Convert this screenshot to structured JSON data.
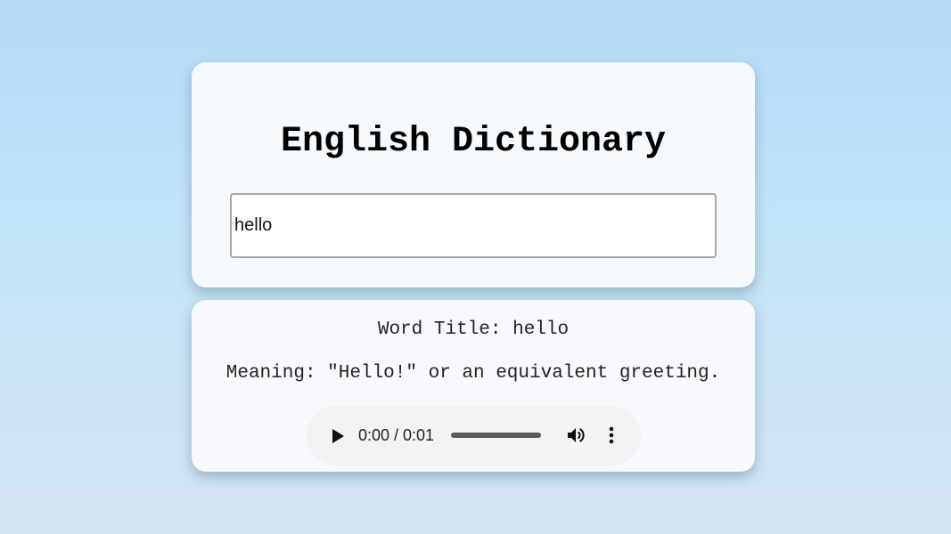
{
  "header": {
    "title": "English Dictionary"
  },
  "search": {
    "value": "hello",
    "placeholder": ""
  },
  "result": {
    "word_title": "Word Title: hello",
    "meaning": "Meaning: \"Hello!\" or an equivalent greeting."
  },
  "audio_player": {
    "time": "0:00 / 0:01",
    "progress": 0,
    "icons": {
      "play": "play-icon",
      "volume": "volume-icon",
      "menu": "more-vert-icon"
    }
  },
  "colors": {
    "background_top": "#b3dbf8",
    "background_bottom": "#d4e4f2",
    "card": "#f6fafd",
    "player": "#f1f3f4"
  }
}
